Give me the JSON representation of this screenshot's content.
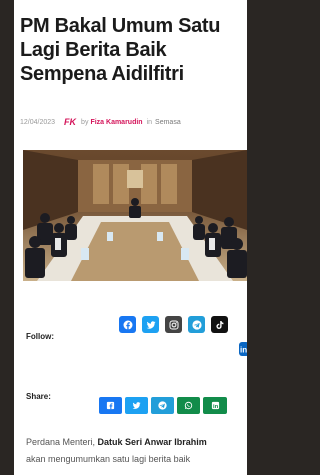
{
  "article": {
    "title_lines": [
      "PM Bakal Umum Satu",
      "Lagi Berita Baik",
      "Sempena Aidilfitri"
    ],
    "date": "12/04/2023",
    "site_mark": "FK",
    "by_prefix": "by",
    "author": "Fiza Kamarudin",
    "in_prefix": "in",
    "category": "Semasa",
    "excerpt": {
      "line1_lead": "Perdana Menteri, ",
      "line1_bold": "Datuk Seri Anwar Ibrahim",
      "line2": "akan mengumumkan satu lagi berita baik"
    }
  },
  "follow": {
    "label": "Follow:",
    "icons": [
      "facebook-icon",
      "twitter-icon",
      "instagram-icon",
      "telegram-icon",
      "tiktok-icon",
      "linkedin-icon"
    ]
  },
  "share": {
    "label": "Share:",
    "icons": [
      "facebook-icon",
      "twitter-icon",
      "telegram-icon",
      "whatsapp-icon",
      "linkedin-icon"
    ]
  },
  "colors": {
    "background": "#2a2623",
    "brand_pink": "#d4145a",
    "facebook": "#1877f2",
    "twitter": "#1da1f2",
    "instagram": "#444444",
    "telegram": "#229ed9",
    "tiktok": "#111111",
    "linkedin": "#0a66c2",
    "whatsapp": "#128c4a"
  }
}
